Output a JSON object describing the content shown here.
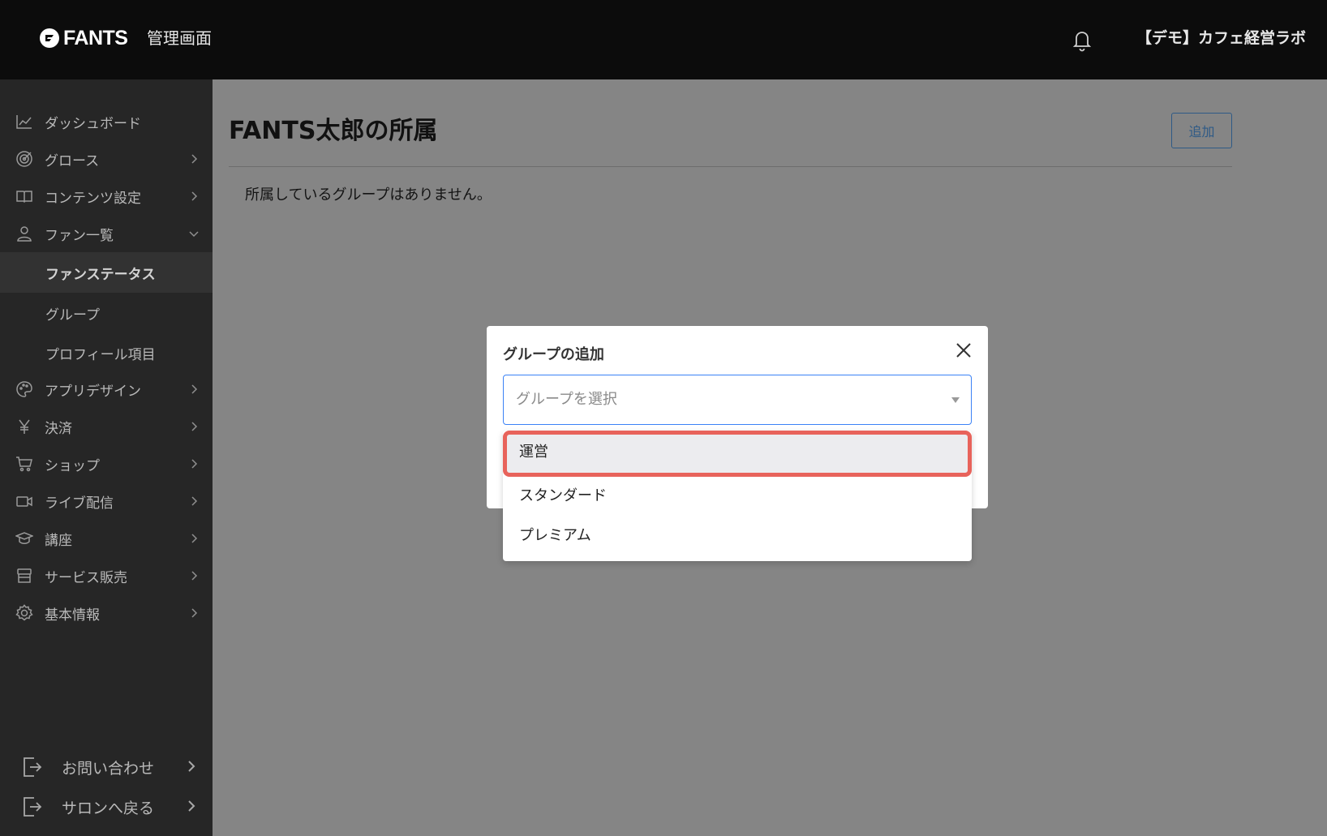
{
  "header": {
    "logo_text": "FANTS",
    "admin_title": "管理画面",
    "org_name": "【デモ】カフェ経営ラボ"
  },
  "sidebar": {
    "items": [
      {
        "label": "ダッシュボード",
        "icon": "chart-line-icon"
      },
      {
        "label": "グロース",
        "icon": "target-icon"
      },
      {
        "label": "コンテンツ設定",
        "icon": "book-icon"
      },
      {
        "label": "ファン一覧",
        "icon": "user-icon"
      },
      {
        "label": "アプリデザイン",
        "icon": "palette-icon"
      },
      {
        "label": "決済",
        "icon": "yen-icon"
      },
      {
        "label": "ショップ",
        "icon": "cart-icon"
      },
      {
        "label": "ライブ配信",
        "icon": "video-icon"
      },
      {
        "label": "講座",
        "icon": "graduation-cap-icon"
      },
      {
        "label": "サービス販売",
        "icon": "store-icon"
      },
      {
        "label": "基本情報",
        "icon": "gear-icon"
      }
    ],
    "sub_items": [
      {
        "label": "ファンステータス"
      },
      {
        "label": "グループ"
      },
      {
        "label": "プロフィール項目"
      }
    ],
    "bottom": [
      {
        "label": "お問い合わせ",
        "icon": "exit-icon"
      },
      {
        "label": "サロンへ戻る",
        "icon": "exit-icon"
      }
    ]
  },
  "main": {
    "title": "FANTS太郎の所属",
    "add_label": "追加",
    "empty_message": "所属しているグループはありません。"
  },
  "modal": {
    "title": "グループの追加",
    "select_placeholder": "グループを選択",
    "options": [
      {
        "label": "運営"
      },
      {
        "label": "スタンダード"
      },
      {
        "label": "プレミアム"
      }
    ]
  },
  "colors": {
    "topbar": "#0c0c0c",
    "sidebar": "#262626",
    "overlay": "#858585",
    "highlight_border": "#e8635b",
    "select_border": "#3b82f6"
  }
}
